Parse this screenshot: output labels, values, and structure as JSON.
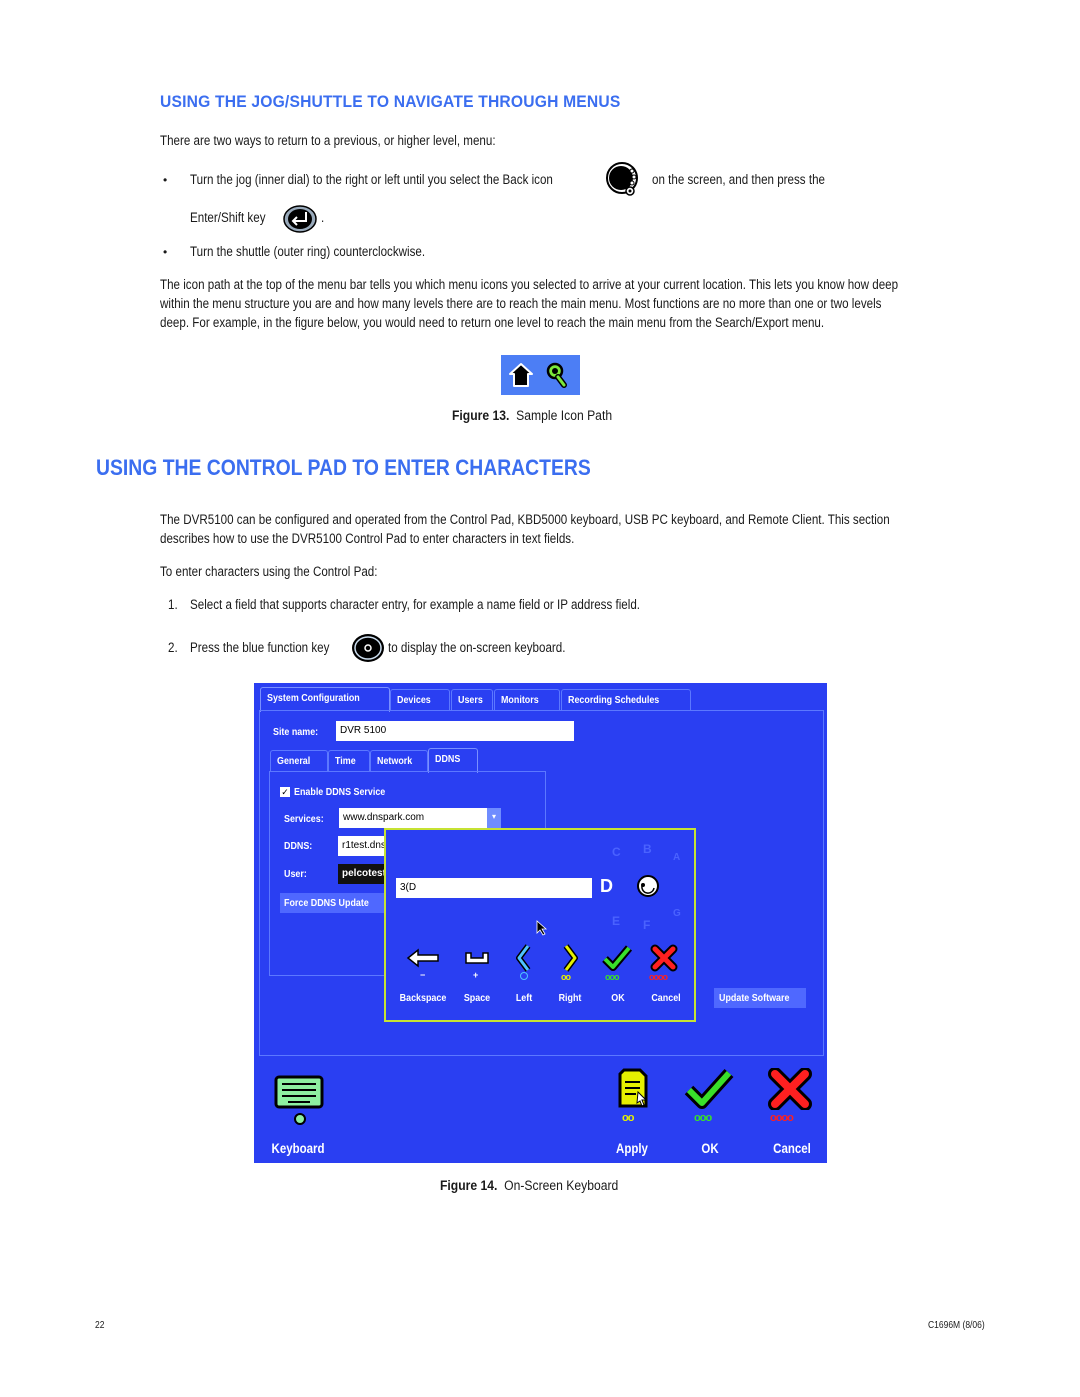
{
  "section1": {
    "heading": "USING THE JOG/SHUTTLE TO NAVIGATE THROUGH MENUS",
    "intro": "There are two ways to return to a previous, or higher level, menu:",
    "bullets": [
      {
        "part1": "Turn the jog (inner dial) to the right or left until you select the Back icon",
        "part2": "on the screen, and then press the",
        "part3": "Enter/Shift key",
        "part4": "."
      },
      {
        "part1": "Turn the shuttle (outer ring) counterclockwise."
      }
    ],
    "paragraph": [
      "The icon path at the top of the menu bar tells you which menu icons you selected to arrive at your current location. This lets you know how deep",
      "within the menu structure you are and how many levels there are to reach the main menu. Most functions are no more than one or two levels",
      "deep. For example, in the figure below, you would need to return one level to reach the main menu from the Search/Export menu."
    ],
    "figure": {
      "number": "Figure 13.",
      "caption": "Sample Icon Path",
      "icons": [
        "home-icon",
        "search-export-icon"
      ]
    }
  },
  "section2": {
    "heading": "USING THE CONTROL PAD TO ENTER CHARACTERS",
    "paragraph": [
      "The DVR5100 can be configured and operated from the Control Pad, KBD5000 keyboard, USB PC keyboard, and Remote Client. This section",
      "describes how to use the DVR5100 Control Pad to enter characters in text fields."
    ],
    "lead": "To enter characters using the Control Pad:",
    "steps": [
      {
        "num": "1.",
        "text": "Select a field that supports character entry, for example a name field or IP address field."
      },
      {
        "num": "2.",
        "text_before": "Press the blue function key",
        "text_after": "to display the on-screen keyboard."
      }
    ],
    "figure": {
      "number": "Figure 14.",
      "caption": "On-Screen Keyboard"
    }
  },
  "screen": {
    "tabs": [
      "System Configuration",
      "Devices",
      "Users",
      "Monitors",
      "Recording Schedules"
    ],
    "site_name_label": "Site name:",
    "site_name_value": "DVR 5100",
    "subtabs": [
      "General",
      "Time",
      "Network",
      "DDNS"
    ],
    "enable_ddns": {
      "label": "Enable DDNS Service",
      "checked": true
    },
    "services_label": "Services:",
    "services_value": "www.dnspark.com",
    "ddns_label": "DDNS:",
    "ddns_value": "r1test.dns",
    "user_label": "User:",
    "user_value": "pelcotest",
    "force_update": "Force DDNS Update",
    "update_software": "Update Software",
    "keyboard": {
      "input_value": "3(D",
      "current_char": "D",
      "ring_chars": [
        "C",
        "B",
        "A",
        "E",
        "F",
        "G"
      ],
      "buttons": [
        {
          "label": "Backspace",
          "hint": "−"
        },
        {
          "label": "Space",
          "hint": "+"
        },
        {
          "label": "Left",
          "hint": "o"
        },
        {
          "label": "Right",
          "hint": "oo"
        },
        {
          "label": "OK",
          "hint": "ooo"
        },
        {
          "label": "Cancel",
          "hint": "oooo"
        }
      ]
    },
    "bottom_buttons": [
      {
        "label": "Keyboard",
        "hint": "o"
      },
      {
        "label": "Apply",
        "hint": "oo"
      },
      {
        "label": "OK",
        "hint": "ooo"
      },
      {
        "label": "Cancel",
        "hint": "oooo"
      }
    ],
    "colors": {
      "background": "#2a3ff2",
      "keyboard_border": "#c6e233",
      "ok_green": "#39e02a",
      "cancel_red": "#ff2020",
      "left_cyan": "#4fc3ff",
      "right_yellow": "#e6f000"
    }
  },
  "footer": {
    "page": "22",
    "doc_id": "C1696M (8/06)"
  }
}
